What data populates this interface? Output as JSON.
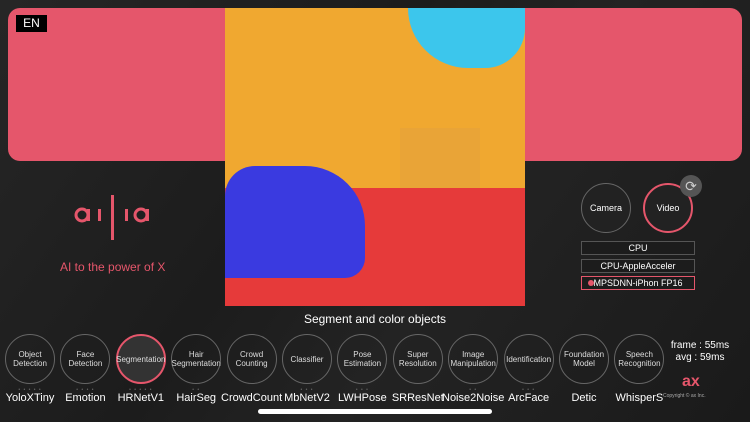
{
  "language": "EN",
  "brand": {
    "logo": "ailia",
    "tagline": "AI to the power of X",
    "accent": "#e5566b"
  },
  "caption": "Segment and color objects",
  "source_modes": [
    {
      "label": "Camera",
      "selected": false
    },
    {
      "label": "Video",
      "selected": true
    }
  ],
  "refresh_icon": "refresh-icon",
  "devices": [
    {
      "label": "CPU",
      "selected": false
    },
    {
      "label": "CPU-AppleAcceler",
      "selected": false
    },
    {
      "label": "MPSDNN-iPhon FP16",
      "selected": true
    }
  ],
  "categories": [
    {
      "label": "Object Detection",
      "model": "YoloXTiny",
      "dots": "• • • • •"
    },
    {
      "label": "Face Detection",
      "model": "Emotion",
      "dots": "• • • •"
    },
    {
      "label": "Segmentation",
      "model": "HRNetV1",
      "dots": "• • • • •",
      "selected": true
    },
    {
      "label": "Hair Segmentation",
      "model": "HairSeg",
      "dots": "• •"
    },
    {
      "label": "Crowd Counting",
      "model": "CrowdCount",
      "dots": ""
    },
    {
      "label": "Classifier",
      "model": "MbNetV2",
      "dots": "• • •"
    },
    {
      "label": "Pose Estimation",
      "model": "LWHPose",
      "dots": "• • •"
    },
    {
      "label": "Super Resolution",
      "model": "SRResNet",
      "dots": ""
    },
    {
      "label": "Image Manipulation",
      "model": "Noise2Noise",
      "dots": "• •"
    },
    {
      "label": "Identification",
      "model": "ArcFace",
      "dots": "• • •"
    },
    {
      "label": "Foundation Model",
      "model": "Detic",
      "dots": ""
    },
    {
      "label": "Speech Recognition",
      "model": "WhisperS",
      "dots": ""
    }
  ],
  "stats": {
    "frame": "frame : 55ms",
    "avg": "avg : 59ms"
  },
  "company": {
    "logo": "ax",
    "copyright": "Copyright © ax Inc."
  }
}
